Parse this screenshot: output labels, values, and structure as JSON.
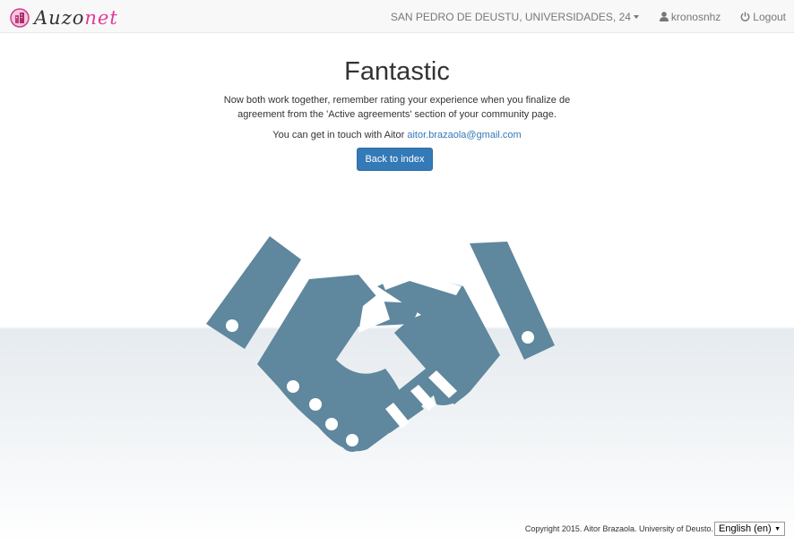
{
  "header": {
    "brand": {
      "part1": "Auzo",
      "part2": "net",
      "logo_icon": "building-logo-icon"
    },
    "location": "SAN PEDRO DE DEUSTU, UNIVERSIDADES, 24",
    "user": "kronosnhz",
    "logout": "Logout"
  },
  "main": {
    "title": "Fantastic",
    "message": "Now both work together, remember rating your experience when you finalize de agreement from the 'Active agreements' section of your community page.",
    "contact_prefix": "You can get in touch with Aitor",
    "contact_email": "aitor.brazaola@gmail.com",
    "back_button": "Back to index",
    "illustration_icon": "handshake-icon"
  },
  "footer": {
    "copyright": "Copyright 2015. Aitor Brazaola. University of Deusto.",
    "language": "English (en)"
  },
  "colors": {
    "accent": "#337ab7",
    "brand_pink": "#e0399a",
    "handshake": "#5f879e"
  }
}
